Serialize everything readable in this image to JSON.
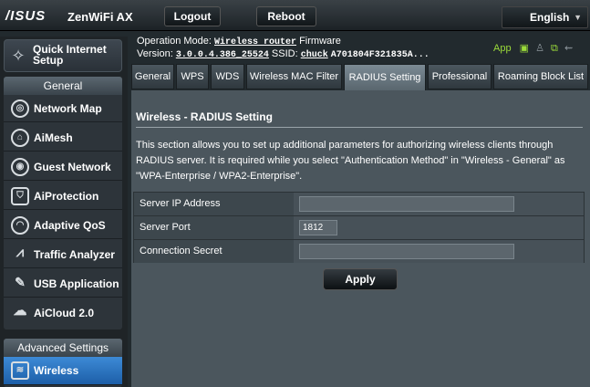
{
  "topbar": {
    "brand": "/ISUS",
    "model": "ZenWiFi AX",
    "logout": "Logout",
    "reboot": "Reboot",
    "language": "English"
  },
  "header": {
    "op_mode_label": "Operation Mode:",
    "op_mode_value": "Wireless router",
    "firmware_label": "Firmware",
    "version_label": "Version:",
    "version_value": "3.0.0.4.386_25524",
    "ssid_label": "SSID:",
    "ssid_value": "chuck",
    "ssid2_value": "A701804F321835A...",
    "app_label": "App"
  },
  "sidebar": {
    "quick_setup": "Quick Internet Setup",
    "general_header": "General",
    "general_items": [
      {
        "label": "Network Map",
        "icon": "network-map-icon"
      },
      {
        "label": "AiMesh",
        "icon": "aimesh-icon"
      },
      {
        "label": "Guest Network",
        "icon": "guest-network-icon"
      },
      {
        "label": "AiProtection",
        "icon": "aiprotection-icon"
      },
      {
        "label": "Adaptive QoS",
        "icon": "adaptive-qos-icon"
      },
      {
        "label": "Traffic Analyzer",
        "icon": "traffic-analyzer-icon"
      },
      {
        "label": "USB Application",
        "icon": "usb-application-icon"
      },
      {
        "label": "AiCloud 2.0",
        "icon": "aicloud-icon"
      }
    ],
    "advanced_header": "Advanced Settings",
    "advanced_items": [
      {
        "label": "Wireless",
        "icon": "wireless-icon",
        "active": true
      }
    ]
  },
  "tabs": [
    {
      "label": "General"
    },
    {
      "label": "WPS"
    },
    {
      "label": "WDS"
    },
    {
      "label": "Wireless MAC Filter"
    },
    {
      "label": "RADIUS Setting",
      "active": true
    },
    {
      "label": "Professional"
    },
    {
      "label": "Roaming Block List"
    }
  ],
  "panel": {
    "title": "Wireless - RADIUS Setting",
    "description": "This section allows you to set up additional parameters for authorizing wireless clients through RADIUS server. It is required while you select \"Authentication Method\" in \"Wireless - General\" as \"WPA-Enterprise / WPA2-Enterprise\".",
    "fields": [
      {
        "label": "Server IP Address",
        "value": ""
      },
      {
        "label": "Server Port",
        "value": "1812"
      },
      {
        "label": "Connection Secret",
        "value": ""
      }
    ],
    "apply": "Apply"
  }
}
